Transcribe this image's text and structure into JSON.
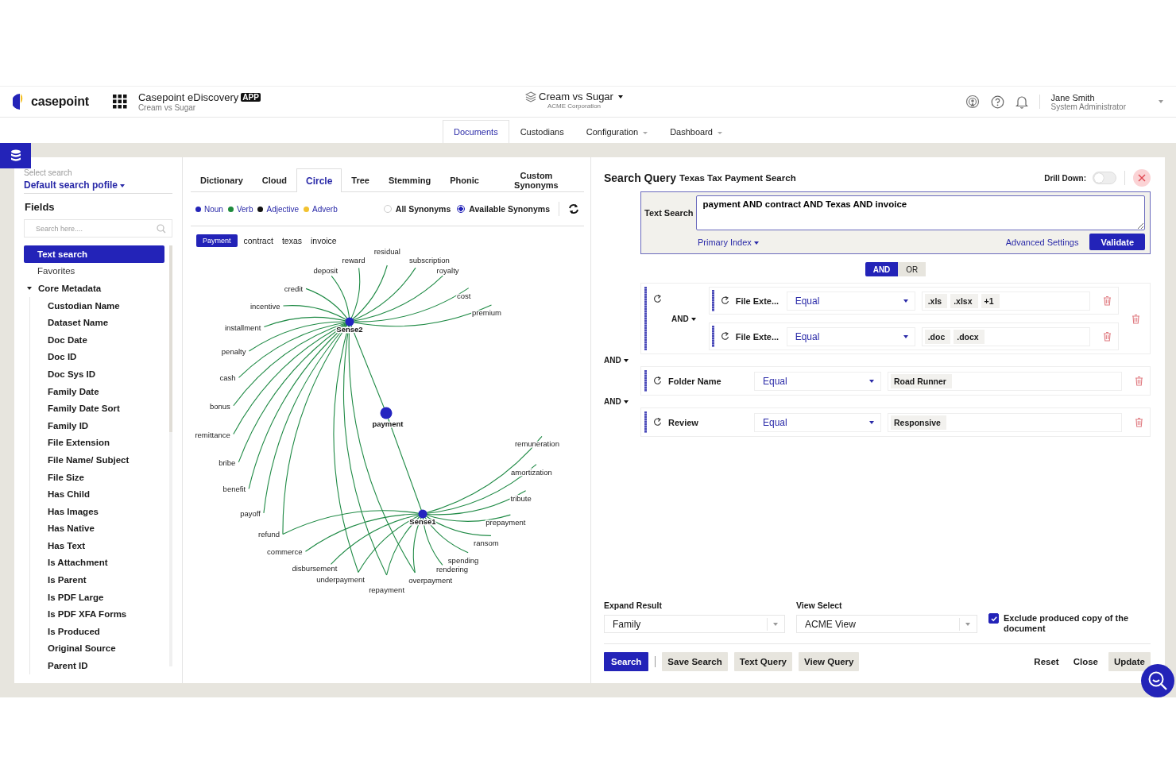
{
  "header": {
    "logo": "casepoint",
    "app_title": "Casepoint eDiscovery",
    "app_badge": "APP",
    "app_subtitle": "Cream vs Sugar",
    "case_name": "Cream vs Sugar",
    "case_org": "ACME Corporation",
    "user_name": "Jane Smith",
    "user_role": "System Administrator"
  },
  "nav": [
    {
      "label": "Documents",
      "selected": true,
      "menu": false
    },
    {
      "label": "Custodians",
      "selected": false,
      "menu": false
    },
    {
      "label": "Configuration",
      "selected": false,
      "menu": true
    },
    {
      "label": "Dashboard",
      "selected": false,
      "menu": true
    }
  ],
  "sidebar": {
    "profile": {
      "placeholder": "Select search",
      "value": "Default search pofile"
    },
    "title": "Fields",
    "search": {
      "placeholder": "Search here...."
    },
    "items": [
      {
        "label": "Text search",
        "selected": true
      },
      {
        "label": "Favorites",
        "selected": false
      },
      {
        "label": "Core Metadata",
        "selected": false,
        "expanded": true,
        "children": [
          {
            "label": "Custodian Name",
            "selected": false
          },
          {
            "label": "Dataset Name",
            "selected": false
          },
          {
            "label": "Doc Date",
            "selected": false
          },
          {
            "label": "Doc ID",
            "selected": false
          },
          {
            "label": "Doc Sys ID",
            "selected": false
          },
          {
            "label": "Family Date",
            "selected": false
          },
          {
            "label": "Family Date Sort",
            "selected": false
          },
          {
            "label": "Family ID",
            "selected": false
          },
          {
            "label": "File Extension",
            "selected": false
          },
          {
            "label": "File Name/ Subject",
            "selected": false
          },
          {
            "label": "File Size",
            "selected": false
          },
          {
            "label": "Has Child",
            "selected": false
          },
          {
            "label": "Has Images",
            "selected": false
          },
          {
            "label": "Has Native",
            "selected": false
          },
          {
            "label": "Has Text",
            "selected": false
          },
          {
            "label": "Is Attachment",
            "selected": false
          },
          {
            "label": "Is Parent",
            "selected": false
          },
          {
            "label": "Is PDF Large",
            "selected": false
          },
          {
            "label": "Is PDF XFA Forms",
            "selected": false
          },
          {
            "label": "Is Produced",
            "selected": false
          },
          {
            "label": "Original Source",
            "selected": false
          },
          {
            "label": "Parent ID",
            "selected": false
          }
        ]
      }
    ]
  },
  "synonyms": {
    "tabs": [
      {
        "label": "Dictionary",
        "selected": false
      },
      {
        "label": "Cloud",
        "selected": false
      },
      {
        "label": "Circle",
        "selected": true
      },
      {
        "label": "Tree",
        "selected": false
      },
      {
        "label": "Stemming",
        "selected": false
      },
      {
        "label": "Phonic",
        "selected": false
      },
      {
        "label": "Custom Synonyms",
        "selected": false
      }
    ],
    "legend": [
      {
        "label": "Noun",
        "color": "#2424b8"
      },
      {
        "label": "Verb",
        "color": "#1d8a3c"
      },
      {
        "label": "Adjective",
        "color": "#111111"
      },
      {
        "label": "Adverb",
        "color": "#f2c230"
      }
    ],
    "modes": [
      {
        "label": "All Synonyms",
        "selected": false
      },
      {
        "label": "Available Synonyms",
        "selected": true
      }
    ],
    "graph": {
      "terms": [
        {
          "label": "Payment",
          "selected": true
        },
        {
          "label": "contract",
          "selected": false
        },
        {
          "label": "texas",
          "selected": false
        },
        {
          "label": "invoice",
          "selected": false
        }
      ],
      "root": "payment",
      "upper_sense": "Sense2",
      "lower_sense": "Sense1",
      "words": [
        {
          "label": "residual",
          "kind": "upper"
        },
        {
          "label": "reward",
          "kind": "upper"
        },
        {
          "label": "subscription",
          "kind": "upper"
        },
        {
          "label": "deposit",
          "kind": "upper"
        },
        {
          "label": "royalty",
          "kind": "upper"
        },
        {
          "label": "credit",
          "kind": "upper"
        },
        {
          "label": "cost",
          "kind": "upper"
        },
        {
          "label": "incentive",
          "kind": "upper"
        },
        {
          "label": "premium",
          "kind": "upper"
        },
        {
          "label": "installment",
          "kind": "upper"
        },
        {
          "label": "penalty",
          "kind": "upper"
        },
        {
          "label": "cash",
          "kind": "upper"
        },
        {
          "label": "bonus",
          "kind": "upper"
        },
        {
          "label": "remittance",
          "kind": "upper"
        },
        {
          "label": "remuneration",
          "kind": "lower"
        },
        {
          "label": "bribe",
          "kind": "upper"
        },
        {
          "label": "amortization",
          "kind": "lower"
        },
        {
          "label": "benefit",
          "kind": "upper"
        },
        {
          "label": "tribute",
          "kind": "lower"
        },
        {
          "label": "payoff",
          "kind": "upper"
        },
        {
          "label": "prepayment",
          "kind": "lower"
        },
        {
          "label": "refund",
          "kind": "both"
        },
        {
          "label": "ransom",
          "kind": "lower"
        },
        {
          "label": "commerce",
          "kind": "lower"
        },
        {
          "label": "spending",
          "kind": "lower"
        },
        {
          "label": "disbursement",
          "kind": "lower"
        },
        {
          "label": "rendering",
          "kind": "lower"
        },
        {
          "label": "underpayment",
          "kind": "both"
        },
        {
          "label": "overpayment",
          "kind": "both"
        },
        {
          "label": "repayment",
          "kind": "both"
        }
      ]
    }
  },
  "query": {
    "title": "Search Query",
    "name": "Texas Tax Payment Search",
    "drill_label": "Drill  Down:",
    "drill_on": false,
    "text_label": "Text Search",
    "text_value": "payment AND contract AND Texas AND invoice",
    "index_link": "Primary Index",
    "advanced_link": "Advanced Settings",
    "validate": "Validate",
    "logic": [
      {
        "label": "AND",
        "selected": true
      },
      {
        "label": "OR",
        "selected": false
      }
    ],
    "conditions": [
      {
        "kind": "group",
        "operator": "AND",
        "children": [
          {
            "field": "File Exte...",
            "operator": "Equal",
            "values": [
              ".xls",
              ".xlsx",
              "+1"
            ]
          },
          {
            "field": "File Exte...",
            "operator": "Equal",
            "values": [
              ".doc",
              ".docx"
            ]
          }
        ]
      },
      {
        "kind": "join",
        "label": "AND"
      },
      {
        "kind": "condition",
        "field": "Folder Name",
        "operator": "Equal",
        "values": [
          "Road Runner"
        ]
      },
      {
        "kind": "join",
        "label": "AND"
      },
      {
        "kind": "condition",
        "field": "Review",
        "operator": "Equal",
        "values": [
          "Responsive"
        ]
      }
    ],
    "expand_label": "Expand Result",
    "expand_value": "Family",
    "view_label": "View Select",
    "view_value": "ACME View",
    "exclude": {
      "label": "Exclude produced copy of the document",
      "checked": true
    },
    "actions": [
      {
        "label": "Search",
        "kind": "primary"
      },
      {
        "label": "Save Search",
        "kind": "secondary"
      },
      {
        "label": "Text Query",
        "kind": "secondary"
      },
      {
        "label": "View Query",
        "kind": "secondary"
      }
    ],
    "end_actions": [
      {
        "label": "Reset",
        "kind": "plain"
      },
      {
        "label": "Close",
        "kind": "plain"
      },
      {
        "label": "Update",
        "kind": "secondary"
      }
    ]
  }
}
